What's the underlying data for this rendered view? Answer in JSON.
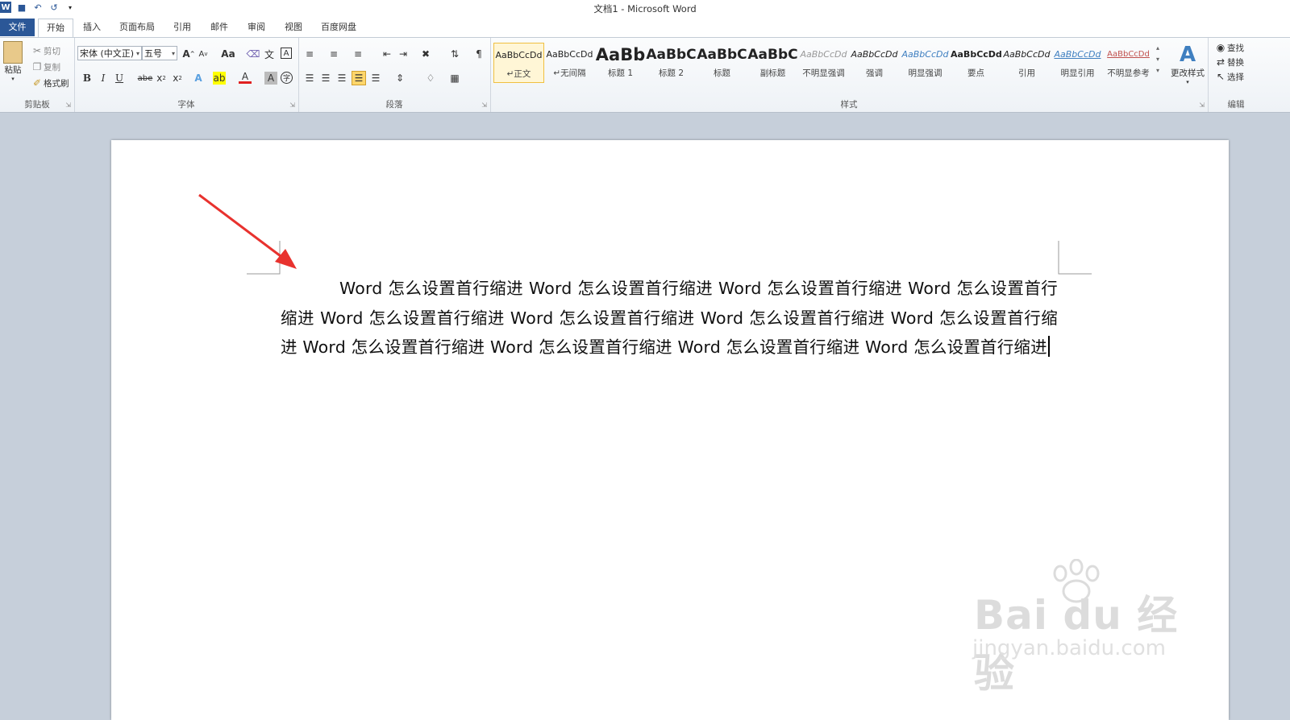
{
  "window": {
    "title": "文档1 - Microsoft Word"
  },
  "qat": {
    "icons": [
      "word-icon",
      "save-icon",
      "undo-icon",
      "redo-icon",
      "customize-icon"
    ]
  },
  "tabs": [
    "文件",
    "开始",
    "插入",
    "页面布局",
    "引用",
    "邮件",
    "审阅",
    "视图",
    "百度网盘"
  ],
  "clipboard": {
    "paste": "粘贴",
    "cut": "剪切",
    "copy": "复制",
    "format_painter": "格式刷",
    "label": "剪贴板"
  },
  "font": {
    "name": "宋体 (中文正)",
    "size": "五号",
    "label": "字体",
    "buttons": [
      "B",
      "I",
      "U",
      "abe",
      "x₂",
      "x²",
      "A",
      "Aa",
      "A"
    ]
  },
  "paragraph": {
    "label": "段落"
  },
  "styles": {
    "label": "样式",
    "items": [
      {
        "preview": "AaBbCcDd",
        "name": "↵正文"
      },
      {
        "preview": "AaBbCcDd",
        "name": "↵无间隔"
      },
      {
        "preview": "AaBb",
        "name": "标题 1"
      },
      {
        "preview": "AaBbC",
        "name": "标题 2"
      },
      {
        "preview": "AaBbC",
        "name": "标题"
      },
      {
        "preview": "AaBbC",
        "name": "副标题"
      },
      {
        "preview": "AaBbCcDd",
        "name": "不明显强调"
      },
      {
        "preview": "AaBbCcDd",
        "name": "强调"
      },
      {
        "preview": "AaBbCcDd",
        "name": "明显强调"
      },
      {
        "preview": "AaBbCcDd",
        "name": "要点"
      },
      {
        "preview": "AaBbCcDd",
        "name": "引用"
      },
      {
        "preview": "AaBbCcDd",
        "name": "明显引用"
      },
      {
        "preview": "AaBbCcDd",
        "name": "不明显参考"
      }
    ],
    "change_styles": "更改样式"
  },
  "editing": {
    "find": "查找",
    "replace": "替换",
    "select": "选择",
    "label": "编辑"
  },
  "document": {
    "paragraph": "Word 怎么设置首行缩进 Word 怎么设置首行缩进 Word 怎么设置首行缩进 Word 怎么设置首行缩进 Word 怎么设置首行缩进 Word 怎么设置首行缩进 Word 怎么设置首行缩进 Word 怎么设置首行缩进 Word 怎么设置首行缩进 Word 怎么设置首行缩进 Word 怎么设置首行缩进 Word 怎么设置首行缩进"
  },
  "watermark": {
    "logo": "Bai du 经验",
    "url": "jingyan.baidu.com"
  },
  "colors": {
    "accent": "#2b5797",
    "arrow": "#e8322e",
    "selected_style": "#f0c040"
  }
}
